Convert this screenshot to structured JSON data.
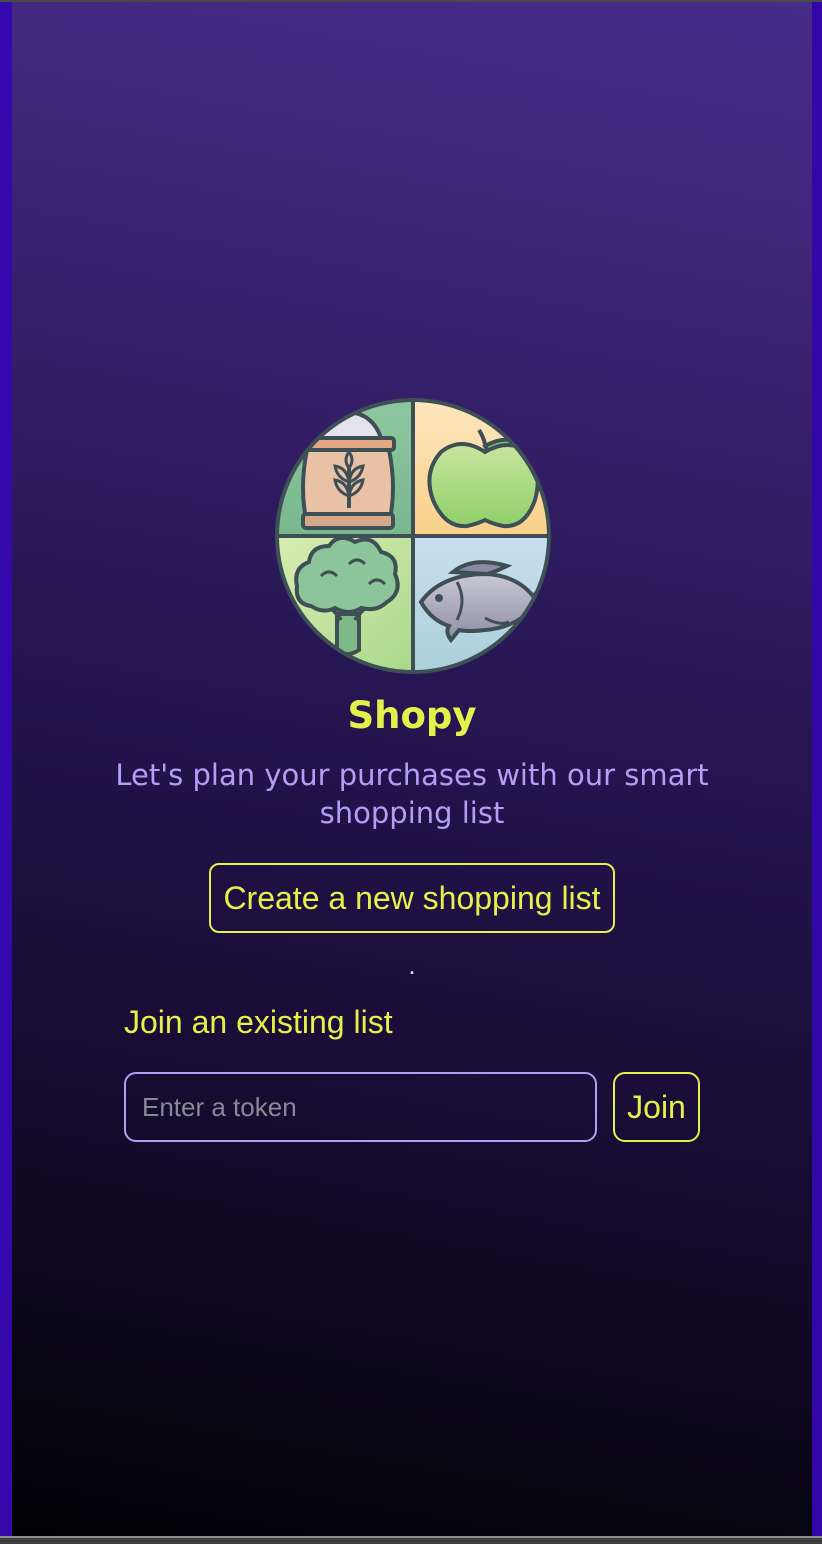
{
  "app": {
    "title": "Shopy",
    "tagline": "Let's plan your purchases with our smart shopping list"
  },
  "actions": {
    "create_label": "Create a new shopping list",
    "separator": "."
  },
  "join": {
    "heading": "Join an existing list",
    "token_placeholder": "Enter a token",
    "token_value": "",
    "button_label": "Join"
  },
  "logo": {
    "icons": [
      "grain-sack-icon",
      "apple-icon",
      "broccoli-icon",
      "fish-icon"
    ]
  },
  "colors": {
    "accent": "#e4f14a",
    "secondary": "#b29ef5",
    "gradient_top": "#472c8a",
    "gradient_bottom": "#020104"
  }
}
